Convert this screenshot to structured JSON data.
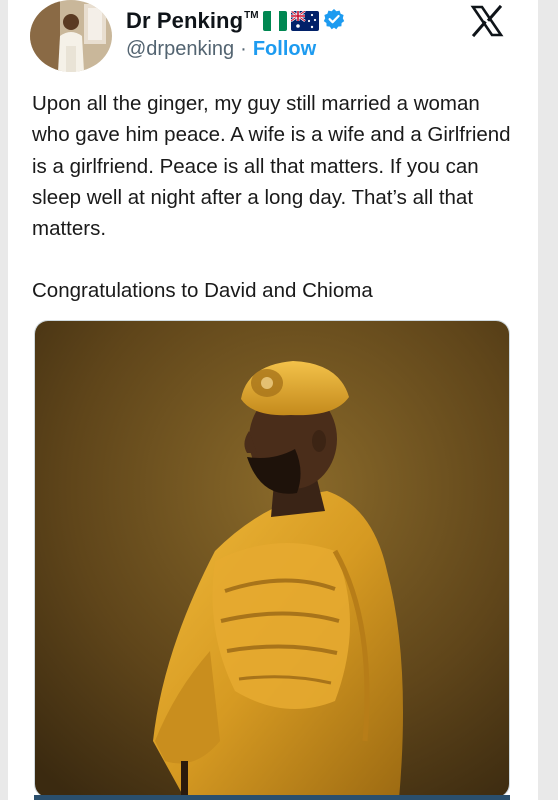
{
  "author": {
    "display_name": "Dr Penking",
    "trademark": "TM",
    "handle": "@drpenking",
    "separator": "·",
    "follow_label": "Follow",
    "verified": true,
    "flags": [
      "nigeria-flag",
      "australia-flag"
    ]
  },
  "tweet": {
    "paragraph_1": "Upon all the ginger, my guy still married a woman who gave him peace. A wife is a wife and a Girlfriend is a girlfriend. Peace is all that matters. If you can sleep well at night after a long day. That’s all that matters.",
    "paragraph_2": "Congratulations to David and Chioma"
  },
  "icons": {
    "platform_logo": "x-logo-icon",
    "verified_badge": "verified-badge-icon"
  },
  "colors": {
    "link_blue": "#1d9bf0",
    "handle_gray": "#536471",
    "photo_background": "#6b4d18",
    "robe_gold": "#d9a22a"
  }
}
